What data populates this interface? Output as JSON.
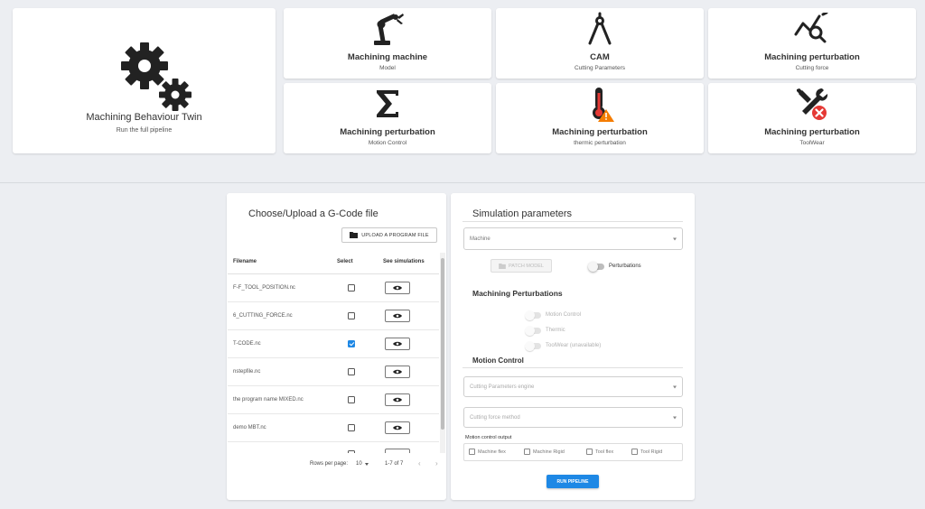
{
  "tiles": {
    "hero": {
      "title": "Machining Behaviour Twin",
      "subtitle": "Run the full pipeline"
    },
    "t1": {
      "title": "Machining machine",
      "subtitle": "Model"
    },
    "t2": {
      "title": "CAM",
      "subtitle": "Cutting Parameters"
    },
    "t3": {
      "title": "Machining perturbation",
      "subtitle": "Cutting force"
    },
    "t4": {
      "title": "Machining perturbation",
      "subtitle": "Motion Control"
    },
    "t5": {
      "title": "Machining perturbation",
      "subtitle": "thermic perturbation"
    },
    "t6": {
      "title": "Machining perturbation",
      "subtitle": "ToolWear"
    }
  },
  "gcode": {
    "title": "Choose/Upload a G-Code file",
    "upload_label": "UPLOAD A PROGRAM FILE",
    "columns": {
      "filename": "Filename",
      "select": "Select",
      "see": "See simulations"
    },
    "rows": [
      {
        "name": "F-F_TOOL_POSITION.nc",
        "checked": false
      },
      {
        "name": "6_CUTTING_FORCE.nc",
        "checked": false
      },
      {
        "name": "T-CODE.nc",
        "checked": true
      },
      {
        "name": "nstepfile.nc",
        "checked": false
      },
      {
        "name": "the program name MIXED.nc",
        "checked": false
      },
      {
        "name": "demo MBT.nc",
        "checked": false
      }
    ],
    "rows_per_page_label": "Rows per page:",
    "rows_per_page_value": "10",
    "range": "1-7 of 7"
  },
  "sim": {
    "title": "Simulation parameters",
    "machine_select": "Machine",
    "model_button": "PATCH MODEL",
    "perturbations_label": "Perturbations",
    "machining_perturbations_title": "Machining Perturbations",
    "perturbation_options": [
      "Motion Control",
      "Thermic",
      "ToolWear (unavailable)"
    ],
    "motion_control_title": "Motion Control",
    "cutting_engine_select": "Cutting Parameters engine",
    "cutting_force_select": "Cutting force method",
    "output_label": "Motion control output",
    "outputs": [
      "Machine flex",
      "Machine Rigid",
      "Tool flex",
      "Tool Rigid"
    ],
    "run_label": "RUN PIPELINE"
  }
}
